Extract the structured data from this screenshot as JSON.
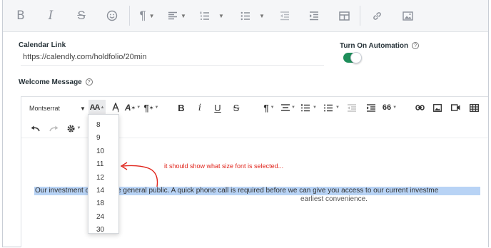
{
  "toolbar_top": {
    "icons": [
      "bold-icon",
      "italic-icon",
      "strikethrough-icon",
      "emoji-icon",
      "paragraph-icon",
      "align-icon",
      "ordered-list-icon",
      "unordered-list-icon",
      "outdent-icon",
      "indent-icon",
      "table-icon",
      "link-icon",
      "image-icon"
    ],
    "bold": "B",
    "italic": "I",
    "strike": "S",
    "paragraph": "¶"
  },
  "form": {
    "calendar_label": "Calendar Link",
    "calendar_value": "https://calendly.com/holdfolio/20min",
    "automation_label": "Turn On Automation",
    "automation_on": true,
    "welcome_label": "Welcome Message",
    "help_glyph": "?"
  },
  "editor": {
    "font_family": "Montserrat",
    "font_size_glyph": "AA",
    "bold": "B",
    "italic": "i",
    "underline": "U",
    "strike": "S",
    "paragraph": "¶",
    "quote": "66",
    "font_size_options": [
      "8",
      "9",
      "10",
      "11",
      "12",
      "14",
      "18",
      "24",
      "30"
    ],
    "body_line1": "Our investment                 open to the general public. A quick phone call is required before we can give you access to our current investme",
    "body_line2": "earliest convenience.",
    "annotation": "it should show what size font is selected..."
  },
  "colors": {
    "accent_green": "#1e8e5a",
    "highlight": "#b8d3f5",
    "annotation_red": "#e0241b"
  }
}
